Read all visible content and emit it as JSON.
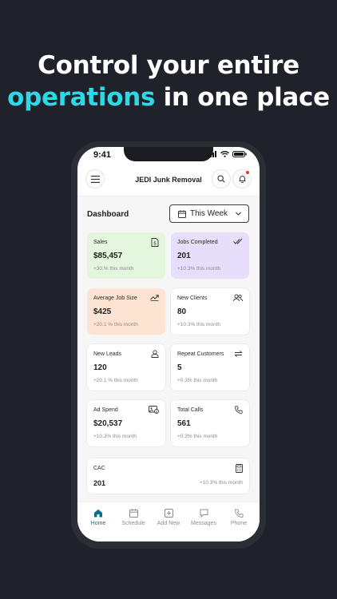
{
  "headline": {
    "line1": "Control your entire",
    "accent": "operations",
    "line2_rest": " in one place"
  },
  "status": {
    "time": "9:41"
  },
  "app": {
    "title": "JEDI Junk Removal",
    "icons": {
      "menu": "menu-icon",
      "search": "search-icon",
      "bell": "bell-icon"
    }
  },
  "dashboard": {
    "title": "Dashboard",
    "period": "This Week",
    "cards": [
      {
        "label": "Sales",
        "value": "$85,457",
        "change": "+30.% this month",
        "icon": "dollar-doc-icon"
      },
      {
        "label": "Jobs Completed",
        "value": "201",
        "change": "+10.3% this month",
        "icon": "double-check-icon"
      },
      {
        "label": "Average Job Size",
        "value": "$425",
        "change": "+20.1 % this month",
        "icon": "trend-up-icon"
      },
      {
        "label": "New Clients",
        "value": "80",
        "change": "+10.3% this month",
        "icon": "users-icon"
      },
      {
        "label": "New Leads",
        "value": "120",
        "change": "+20.1 % this month",
        "icon": "lead-icon"
      },
      {
        "label": "Repeat Customers",
        "value": "5",
        "change": "+0.3% this month",
        "icon": "repeat-icon"
      },
      {
        "label": "Ad Spend",
        "value": "$20,537",
        "change": "+10.3% this month",
        "icon": "ad-icon"
      },
      {
        "label": "Total Calls",
        "value": "561",
        "change": "+0.3% this month",
        "icon": "phone-icon"
      }
    ],
    "cac": {
      "label": "CAC",
      "value": "201",
      "change": "+10.3% this month",
      "icon": "calculator-icon"
    }
  },
  "nav": {
    "items": [
      {
        "label": "Home",
        "icon": "home-icon",
        "active": true
      },
      {
        "label": "Schedule",
        "icon": "calendar-icon",
        "active": false
      },
      {
        "label": "Add New",
        "icon": "plus-square-icon",
        "active": false
      },
      {
        "label": "Messages",
        "icon": "message-icon",
        "active": false
      },
      {
        "label": "Phone",
        "icon": "phone-icon",
        "active": false
      }
    ]
  },
  "colors": {
    "background": "#1f222a",
    "accent": "#2fd8e6",
    "active_nav": "#0f6d8c",
    "card_green": "#e4f6dd",
    "card_purple": "#e6defa",
    "card_peach": "#fde3d2"
  }
}
